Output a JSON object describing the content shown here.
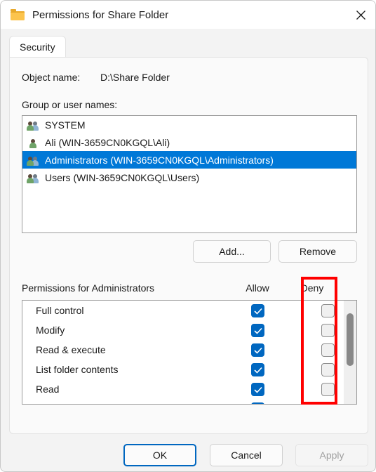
{
  "window": {
    "title": "Permissions for Share Folder",
    "icon": "folder-icon",
    "close_label": "✕"
  },
  "tabs": [
    {
      "label": "Security",
      "selected": true
    }
  ],
  "object_name": {
    "label": "Object name:",
    "value": "D:\\Share Folder"
  },
  "group_section": {
    "label": "Group or user names:",
    "items": [
      {
        "name": "SYSTEM",
        "icon": "group-icon",
        "selected": false
      },
      {
        "name": "Ali (WIN-3659CN0KGQL\\Ali)",
        "icon": "user-icon",
        "selected": false
      },
      {
        "name": "Administrators (WIN-3659CN0KGQL\\Administrators)",
        "icon": "group-icon",
        "selected": true
      },
      {
        "name": "Users (WIN-3659CN0KGQL\\Users)",
        "icon": "group-icon",
        "selected": false
      }
    ],
    "add_label": "Add...",
    "remove_label": "Remove"
  },
  "permissions_section": {
    "title": "Permissions for Administrators",
    "allow_column": "Allow",
    "deny_column": "Deny",
    "rows": [
      {
        "name": "Full control",
        "allow": true,
        "deny": false
      },
      {
        "name": "Modify",
        "allow": true,
        "deny": false
      },
      {
        "name": "Read & execute",
        "allow": true,
        "deny": false
      },
      {
        "name": "List folder contents",
        "allow": true,
        "deny": false
      },
      {
        "name": "Read",
        "allow": true,
        "deny": false
      }
    ]
  },
  "annotation": {
    "highlight_target": "deny-column",
    "color": "#ff0000"
  },
  "footer": {
    "ok_label": "OK",
    "cancel_label": "Cancel",
    "apply_label": "Apply",
    "apply_enabled": false
  },
  "colors": {
    "selection_blue": "#0078d7",
    "checkbox_blue": "#0067c0",
    "annotation_red": "#ff0000",
    "dialog_bg": "#f3f3f3"
  }
}
